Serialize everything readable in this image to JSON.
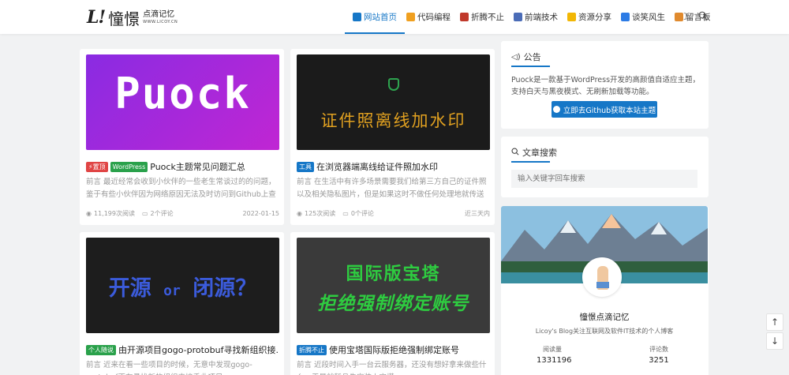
{
  "logo": {
    "mark": "L!",
    "title": "憧憬",
    "sub_title": "点滴记忆",
    "sub_url": "WWW.LICOY.CN"
  },
  "nav": {
    "items": [
      {
        "label": "网站首页",
        "icon": "home-icon",
        "color": "#1677c7",
        "active": true
      },
      {
        "label": "代码编程",
        "icon": "code-icon",
        "color": "#f0a020"
      },
      {
        "label": "折腾不止",
        "icon": "toolbox-icon",
        "color": "#c0392b"
      },
      {
        "label": "前端技术",
        "icon": "frontend-icon",
        "color": "#4b6cb7"
      },
      {
        "label": "资源分享",
        "icon": "smile-icon",
        "color": "#f2b705"
      },
      {
        "label": "谈笑风生",
        "icon": "book-icon",
        "color": "#2c7be5"
      },
      {
        "label": "留言板",
        "icon": "hourglass-icon",
        "color": "#e08a2e"
      }
    ],
    "moon_glyph": "☽",
    "search_glyph": "⌕"
  },
  "posts": [
    {
      "thumb_text": "Puock",
      "tags": [
        {
          "label": "⚡置顶",
          "style": "red"
        },
        {
          "label": "WordPress",
          "style": "green"
        }
      ],
      "title": "Puock主题常见问题汇总",
      "excerpt": "前言 最近经常会收到小伙伴的一些老生常谈过的的问题，鉴于有些小伙伴因为网络原因无法及时访问到Github上查看...",
      "views": "11,199次阅读",
      "comments": "2个评论",
      "date": "2022-01-15"
    },
    {
      "thumb_text": "证件照离线加水印",
      "tags": [
        {
          "label": "工具",
          "style": "blue"
        }
      ],
      "title": "在浏览器端离线给证件照加水印",
      "excerpt": "前言 在生活中有许多场景需要我们给第三方自己的证件照以及相关隐私图片，但是如果这时不做任何处理地就传送给...",
      "views": "125次阅读",
      "comments": "0个评论",
      "date": "近三天内"
    },
    {
      "thumb_text_a": "开源",
      "thumb_text_b": "or",
      "thumb_text_c": "闭源？",
      "tags": [
        {
          "label": "个人随说",
          "style": "green"
        }
      ],
      "title": "由开源项目gogo-protobuf寻找新组织接...",
      "excerpt": "前言 近来在看一些项目的时候，无意中发现gogo-protobuf正在寻找新的组织来接手此项目..."
    },
    {
      "thumb_text_a": "国际版宝塔",
      "thumb_text_b": "拒绝强制绑定账号",
      "tags": [
        {
          "label": "折腾不止",
          "style": "blue"
        }
      ],
      "title": "使用宝塔国际版拒绝强制绑定账号",
      "excerpt": "前言 近段时间入手一台云服务器，还没有想好拿来做些什么，于是就暂且先安装上宝塔..."
    }
  ],
  "notice": {
    "title": "公告",
    "text": "Puock是一款基于WordPress开发的高颜值自适应主题，支持白天与黑夜模式、无刷新加载等功能。",
    "button": "立即去Github获取本站主题"
  },
  "search": {
    "title": "文章搜索",
    "placeholder": "输入关键字回车搜索"
  },
  "profile": {
    "name": "憧憬点滴记忆",
    "desc": "Licoy's Blog关注互联网及软件IT技术的个人博客",
    "stats": [
      {
        "label": "阅读量",
        "value": "1331196"
      },
      {
        "label": "评论数",
        "value": "3251"
      }
    ]
  },
  "float": {
    "up": "↑",
    "down": "↓"
  }
}
